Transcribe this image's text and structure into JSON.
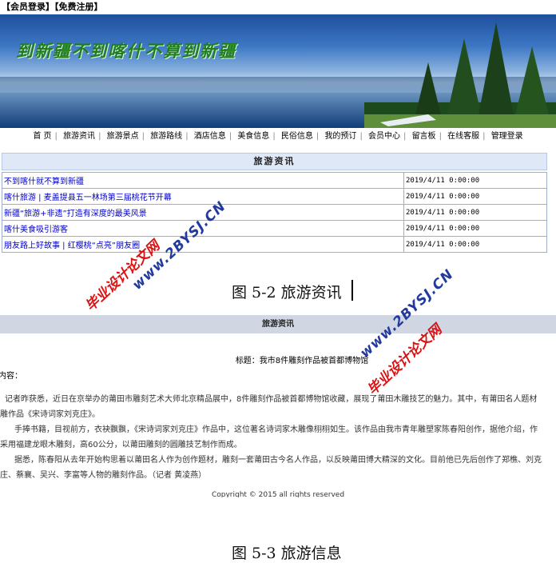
{
  "shot1": {
    "top_links": [
      "【会员登录】",
      "【免费注册】"
    ],
    "banner_slogan": "到新疆不到喀什不算到新疆",
    "nav": [
      "首 页",
      "旅游资讯",
      "旅游景点",
      "旅游路线",
      "酒店信息",
      "美食信息",
      "民俗信息",
      "我的预订",
      "会员中心",
      "留言板",
      "在线客服",
      "管理登录"
    ],
    "panel_title": "旅游资讯",
    "news": [
      {
        "title": "不到喀什就不算到新疆",
        "date": "2019/4/11 0:00:00"
      },
      {
        "title": "喀什旅游 | 麦盖提县五一林场第三届桃花节开幕",
        "date": "2019/4/11 0:00:00"
      },
      {
        "title": "新疆“旅游+非遗”打造有深度的最美风景",
        "date": "2019/4/11 0:00:00"
      },
      {
        "title": "喀什美食吸引游客",
        "date": "2019/4/11 0:00:00"
      },
      {
        "title": "朋友路上好故事 | 红樱桃“点亮”朋友圈",
        "date": "2019/4/11 0:00:00"
      }
    ]
  },
  "captions": {
    "fig2": "图 5-2 旅游资讯",
    "fig3": "图 5-3 旅游信息"
  },
  "shot2": {
    "bar_title": "旅游资讯",
    "title_line": "标题：我市8件雕刻作品被首都博物馆",
    "content_label": "内容：",
    "paragraphs": [
      "记者昨获悉，近日在京举办的莆田市雕刻艺术大师北京精品展中，8件雕刻作品被首都博物馆收藏，展现了莆田木雕技艺的魅力。其中，有莆田名人题材",
      "雕作品《宋诗词家刘克庄》。",
      "手捧书籍，目视前方，衣袂飘飘，《宋诗词家刘克庄》作品中，这位著名诗词家木雕像栩栩如生。该作品由我市青年雕塑家陈春阳创作，据他介绍，作",
      "采用福建龙眼木雕刻，高60公分，以莆田雕刻的圆雕技艺制作而成。",
      "据悉，陈春阳从去年开始构思着以莆田名人作为创作题材，雕刻一套莆田古今名人作品，以反映莆田博大精深的文化。目前他已先后创作了郑樵、刘克",
      "庄、蔡襄、吴兴、李富等人物的雕刻作品。（记者 黄凌燕）"
    ],
    "footer": "Copyright © 2015  all rights reserved"
  },
  "watermarks": {
    "red": "毕业设计论文网",
    "blue": "www.2BYSJ.CN"
  },
  "colors": {
    "link": "#0000cc",
    "panel_head": "#dfe8f6",
    "bar": "#d0d6e2",
    "wm_red": "#d11111",
    "wm_blue": "#223a9e"
  }
}
